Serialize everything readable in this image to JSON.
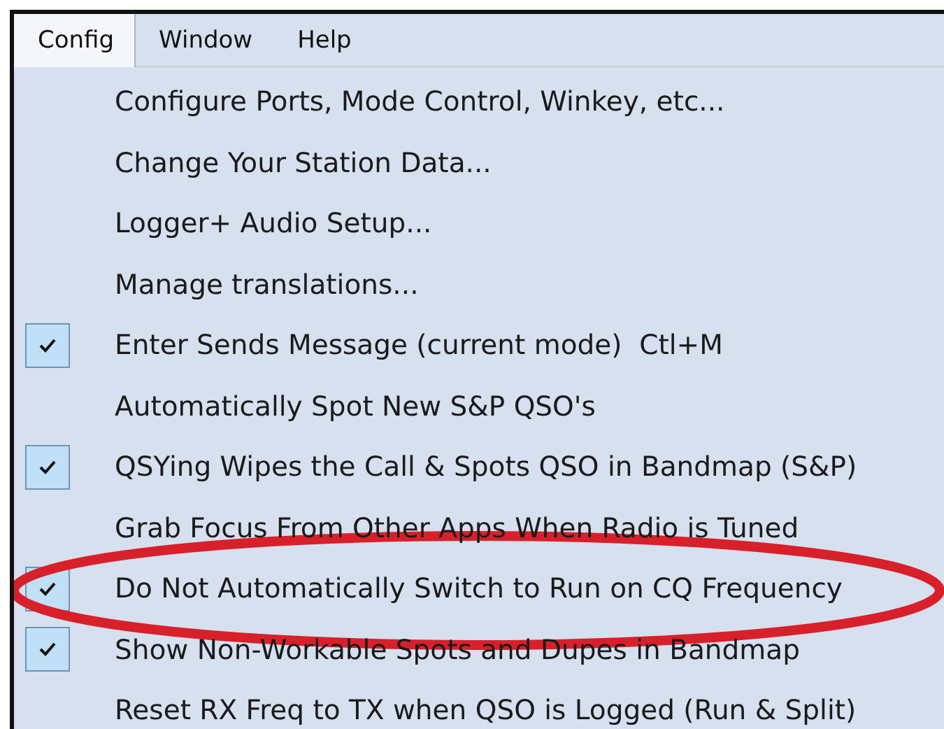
{
  "menu_bar": [
    {
      "label": "Config",
      "selected": true
    },
    {
      "label": "Window",
      "selected": false
    },
    {
      "label": "Help",
      "selected": false
    }
  ],
  "menu_items": [
    {
      "label": "Configure Ports, Mode Control, Winkey, etc...",
      "checked": false,
      "circled": false
    },
    {
      "label": "Change Your Station Data...",
      "checked": false,
      "circled": false
    },
    {
      "label": "Logger+ Audio Setup...",
      "checked": false,
      "circled": false
    },
    {
      "label": "Manage translations...",
      "checked": false,
      "circled": false
    },
    {
      "label": "Enter Sends Message (current mode)  Ctl+M",
      "checked": true,
      "circled": false
    },
    {
      "label": "Automatically Spot New S&P QSO's",
      "checked": false,
      "circled": false
    },
    {
      "label": "QSYing Wipes the Call & Spots QSO in Bandmap (S&P)",
      "checked": true,
      "circled": false
    },
    {
      "label": "Grab Focus From Other Apps When Radio is Tuned",
      "checked": false,
      "circled": false
    },
    {
      "label": "Do Not Automatically Switch to Run on CQ Frequency",
      "checked": true,
      "circled": true
    },
    {
      "label": "Show Non-Workable Spots and Dupes in Bandmap",
      "checked": true,
      "circled": false
    },
    {
      "label": "Reset RX Freq to TX when QSO is Logged (Run & Split)",
      "checked": false,
      "circled": false
    }
  ]
}
